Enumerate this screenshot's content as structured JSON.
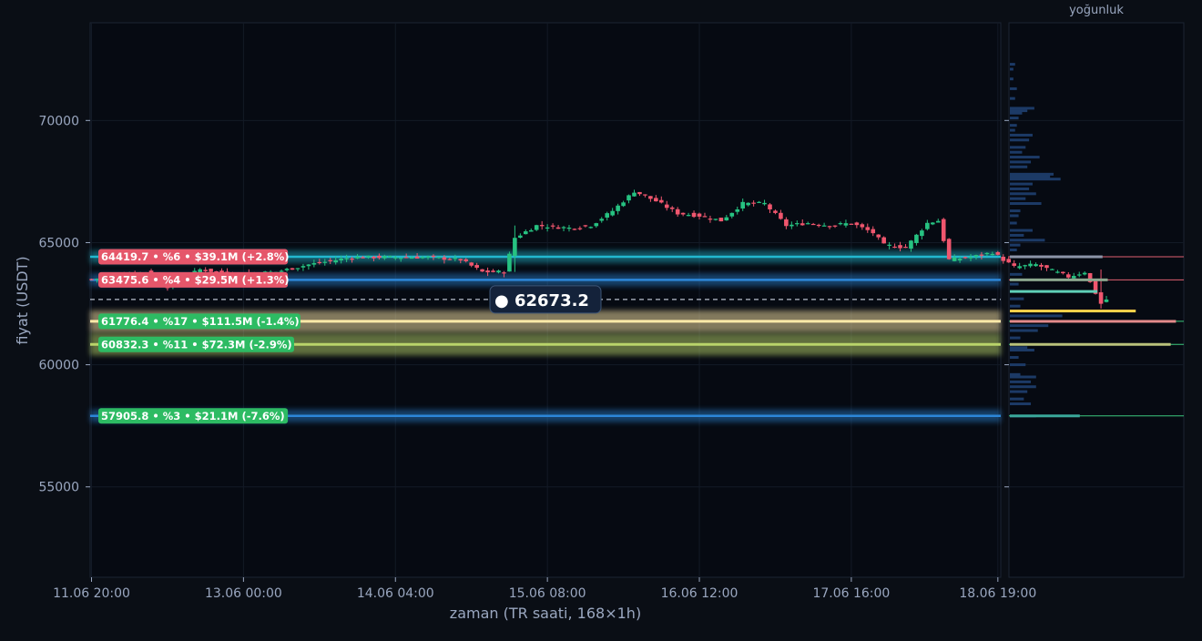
{
  "chart_data": {
    "type": "candlestick",
    "xlabel": "zaman (TR saati, 168×1h)",
    "ylabel": "fiyat (USDT)",
    "ylim": [
      51300,
      74000
    ],
    "yticks": [
      55000,
      60000,
      65000,
      70000
    ],
    "ytick_labels": [
      "55000",
      "60000",
      "65000",
      "70000"
    ],
    "xticks": [
      {
        "label": "11.06 20:00",
        "index": 0
      },
      {
        "label": "13.06 00:00",
        "index": 28
      },
      {
        "label": "14.06 04:00",
        "index": 56
      },
      {
        "label": "15.06 08:00",
        "index": 84
      },
      {
        "label": "16.06 12:00",
        "index": 112
      },
      {
        "label": "17.06 16:00",
        "index": 140
      },
      {
        "label": "18.06 19:00",
        "index": 167
      }
    ],
    "bar_count": 168,
    "current_price": 62673.2,
    "current_price_label": "● 62673.2",
    "price_path": [
      [
        0,
        63500
      ],
      [
        10,
        63800
      ],
      [
        14,
        63200
      ],
      [
        20,
        63900
      ],
      [
        26,
        63700
      ],
      [
        34,
        63800
      ],
      [
        40,
        64100
      ],
      [
        48,
        64400
      ],
      [
        56,
        64400
      ],
      [
        62,
        64400
      ],
      [
        68,
        64300
      ],
      [
        72,
        63800
      ],
      [
        76,
        63800
      ],
      [
        78,
        65200
      ],
      [
        82,
        65700
      ],
      [
        88,
        65600
      ],
      [
        92,
        65700
      ],
      [
        96,
        66300
      ],
      [
        100,
        67100
      ],
      [
        104,
        66700
      ],
      [
        108,
        66200
      ],
      [
        112,
        66100
      ],
      [
        116,
        65900
      ],
      [
        120,
        66600
      ],
      [
        124,
        66600
      ],
      [
        128,
        65700
      ],
      [
        132,
        65800
      ],
      [
        136,
        65700
      ],
      [
        140,
        65800
      ],
      [
        144,
        65400
      ],
      [
        146,
        64900
      ],
      [
        150,
        64800
      ],
      [
        154,
        65800
      ],
      [
        156,
        65900
      ],
      [
        158,
        64300
      ],
      [
        162,
        64400
      ],
      [
        166,
        64600
      ],
      [
        170,
        64000
      ],
      [
        174,
        64100
      ],
      [
        180,
        63600
      ],
      [
        183,
        63800
      ],
      [
        186,
        62500
      ],
      [
        187,
        62673
      ]
    ],
    "levels": [
      {
        "price": 64419.7,
        "label": "64419.7 • %6 • $39.1M (+2.8%)",
        "side": "resistance",
        "line_color": "#22b8cf"
      },
      {
        "price": 63475.6,
        "label": "63475.6 • %4 • $29.5M (+1.3%)",
        "side": "resistance",
        "line_color": "#2c86d8"
      },
      {
        "price": 61776.4,
        "label": "61776.4 • %17 • $111.5M (-1.4%)",
        "side": "support",
        "line_color": "#ffe9a8"
      },
      {
        "price": 60832.3,
        "label": "60832.3 • %11 • $72.3M (-2.9%)",
        "side": "support",
        "line_color": "#b9d46a"
      },
      {
        "price": 57905.8,
        "label": "57905.8 • %3 • $21.1M (-7.6%)",
        "side": "support",
        "line_color": "#2c86d8"
      }
    ],
    "density_title": "yoğunluk",
    "density_bars": [
      [
        72300,
        0.03
      ],
      [
        72100,
        0.02
      ],
      [
        71700,
        0.02
      ],
      [
        71300,
        0.04
      ],
      [
        70900,
        0.03
      ],
      [
        70500,
        0.14
      ],
      [
        70400,
        0.1
      ],
      [
        70300,
        0.07
      ],
      [
        70100,
        0.05
      ],
      [
        69800,
        0.04
      ],
      [
        69600,
        0.03
      ],
      [
        69400,
        0.13
      ],
      [
        69200,
        0.11
      ],
      [
        68900,
        0.09
      ],
      [
        68700,
        0.07
      ],
      [
        68500,
        0.17
      ],
      [
        68300,
        0.12
      ],
      [
        68100,
        0.1
      ],
      [
        67800,
        0.25
      ],
      [
        67700,
        0.23
      ],
      [
        67600,
        0.29
      ],
      [
        67400,
        0.13
      ],
      [
        67200,
        0.11
      ],
      [
        67000,
        0.15
      ],
      [
        66800,
        0.09
      ],
      [
        66600,
        0.18
      ],
      [
        66300,
        0.06
      ],
      [
        66100,
        0.05
      ],
      [
        65800,
        0.04
      ],
      [
        65500,
        0.13
      ],
      [
        65300,
        0.08
      ],
      [
        65100,
        0.2
      ],
      [
        64900,
        0.06
      ],
      [
        64700,
        0.04
      ],
      [
        63700,
        0.07
      ],
      [
        63300,
        0.05
      ],
      [
        62700,
        0.08
      ],
      [
        62400,
        0.06
      ],
      [
        62000,
        0.3
      ],
      [
        61600,
        0.22
      ],
      [
        61400,
        0.16
      ],
      [
        61100,
        0.06
      ],
      [
        60700,
        0.1
      ],
      [
        60600,
        0.14
      ],
      [
        60300,
        0.05
      ],
      [
        60000,
        0.09
      ],
      [
        59600,
        0.06
      ],
      [
        59500,
        0.15
      ],
      [
        59300,
        0.12
      ],
      [
        59100,
        0.15
      ],
      [
        58900,
        0.1
      ],
      [
        58600,
        0.08
      ],
      [
        58400,
        0.12
      ],
      [
        57900,
        0.15
      ]
    ],
    "density_level_bars": [
      {
        "price": 64419.7,
        "value": 0.53,
        "color": "#8d95a8",
        "line": "#e06070"
      },
      {
        "price": 63475.6,
        "value": 0.56,
        "color": "#8ca88f",
        "line": "#e06070"
      },
      {
        "price": 63000,
        "value": 0.5,
        "color": "#5fd0b8",
        "line": ""
      },
      {
        "price": 62200,
        "value": 0.72,
        "color": "#ffd24a",
        "line": ""
      },
      {
        "price": 61776.4,
        "value": 0.95,
        "color": "#e28a8a",
        "line": "#3bc87c"
      },
      {
        "price": 60832.3,
        "value": 0.92,
        "color": "#b9c17a",
        "line": "#3bc87c"
      },
      {
        "price": 57905.8,
        "value": 0.4,
        "color": "#3aa89a",
        "line": "#3bc87c"
      }
    ]
  }
}
